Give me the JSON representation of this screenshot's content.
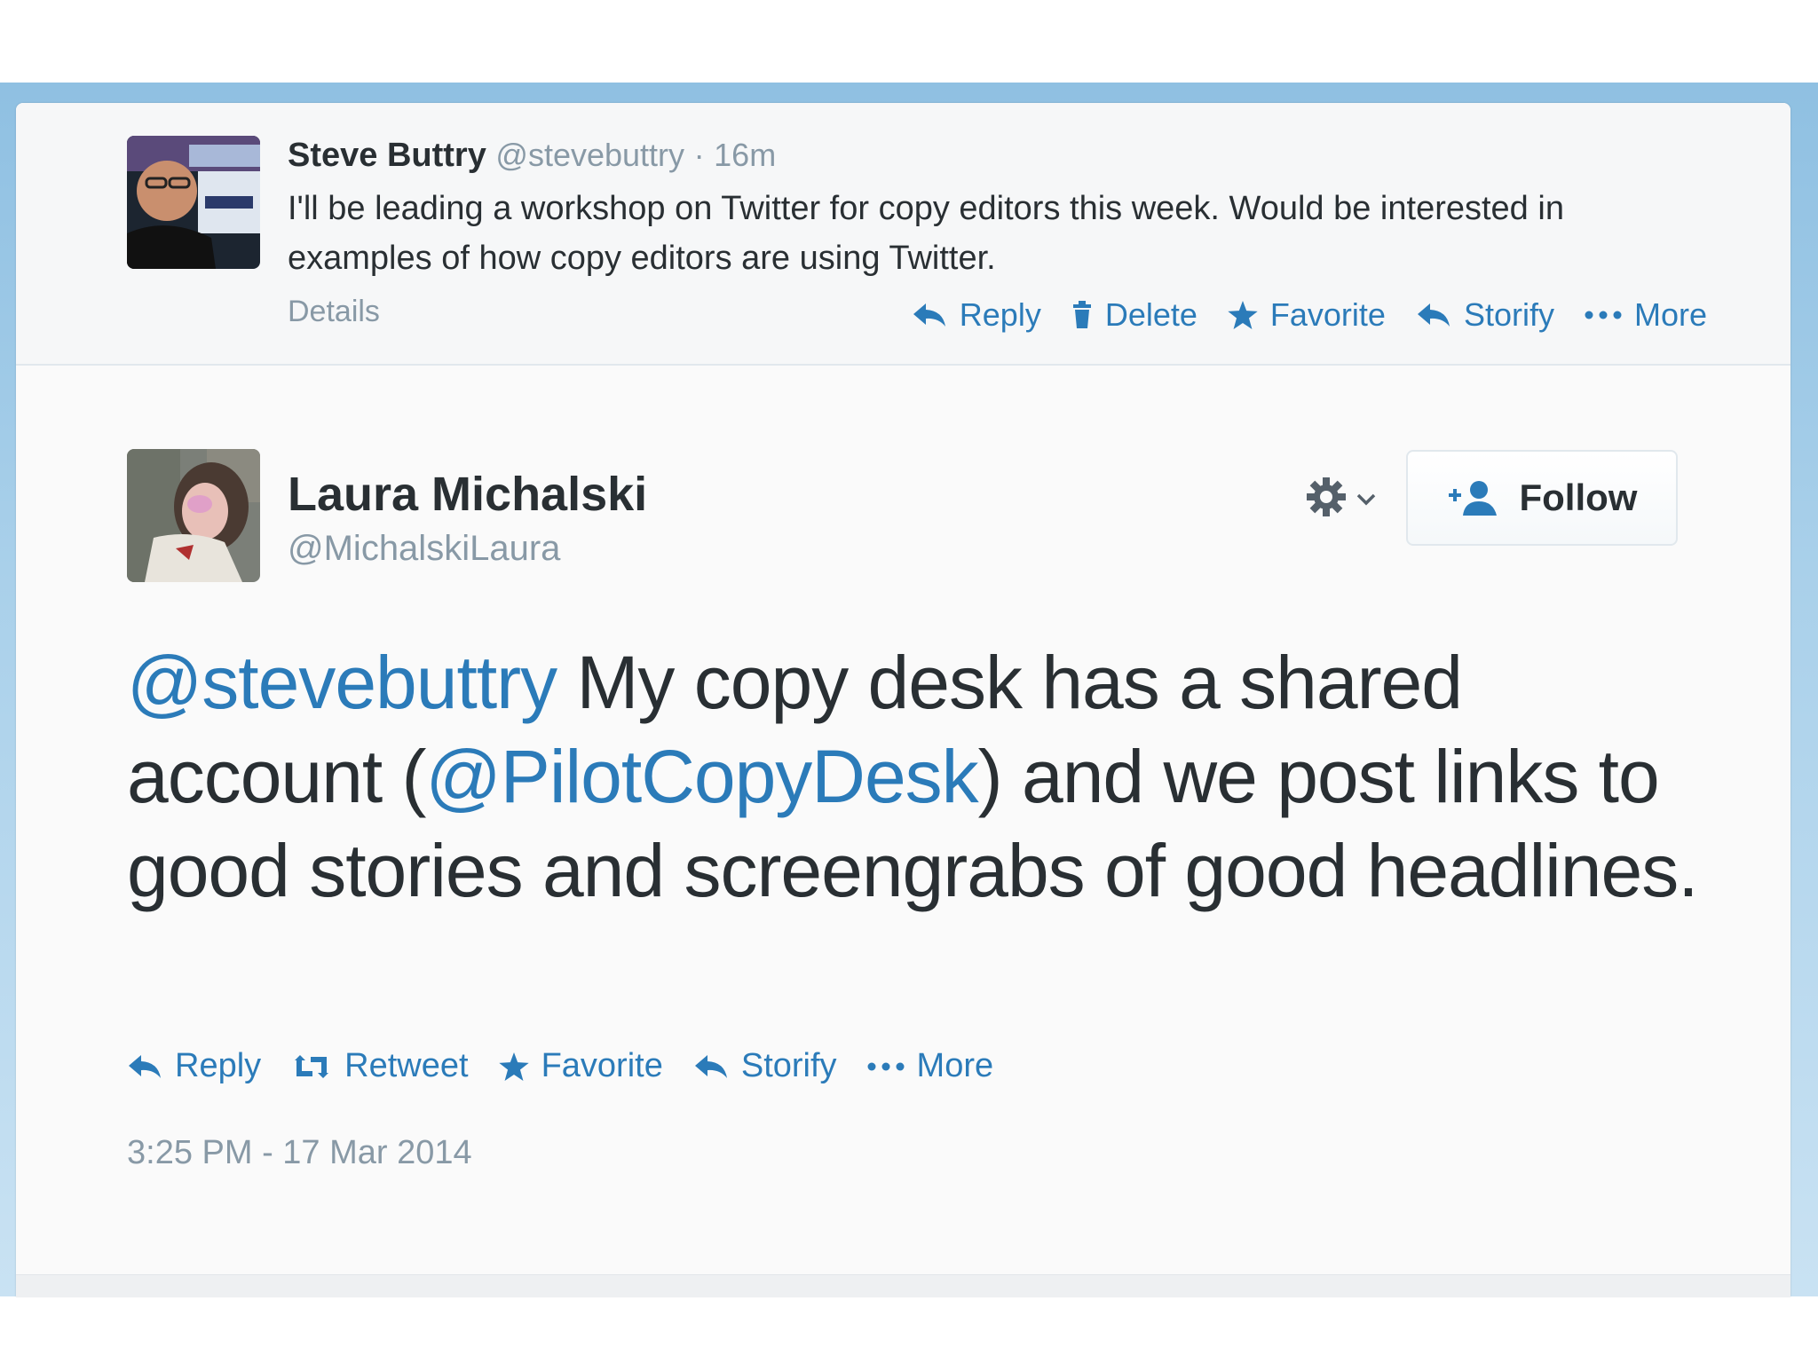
{
  "parent_tweet": {
    "author_name": "Steve Buttry",
    "handle": "@stevebuttry",
    "separator": "·",
    "time_ago": "16m",
    "text": "I'll be leading a workshop on Twitter for copy editors this week. Would be interested in examples of how copy editors are using Twitter.",
    "details_label": "Details",
    "actions": {
      "reply": "Reply",
      "delete": "Delete",
      "favorite": "Favorite",
      "storify": "Storify",
      "more": "More"
    }
  },
  "focal_tweet": {
    "author_name": "Laura Michalski",
    "handle": "@MichalskiLaura",
    "follow_label": "Follow",
    "text_parts": {
      "mention_1": "@stevebuttry",
      "text_1": " My copy desk has a shared account (",
      "mention_2": "@PilotCopyDesk",
      "text_2": ") and we post links to good stories and screengrabs of good headlines."
    },
    "actions": {
      "reply": "Reply",
      "retweet": "Retweet",
      "favorite": "Favorite",
      "storify": "Storify",
      "more": "More"
    },
    "timestamp": "3:25 PM - 17 Mar 2014"
  },
  "icons": {
    "reply": "reply-arrow-icon",
    "delete": "trash-icon",
    "favorite": "star-icon",
    "storify": "storify-arrow-icon",
    "more": "ellipsis-icon",
    "retweet": "retweet-icon",
    "gear": "gear-icon",
    "chevron": "chevron-down-icon",
    "follow": "add-user-icon"
  },
  "colors": {
    "link": "#2b7bb9",
    "text": "#292f33",
    "muted": "#8899a6",
    "backdrop": "#a9d0ea"
  }
}
